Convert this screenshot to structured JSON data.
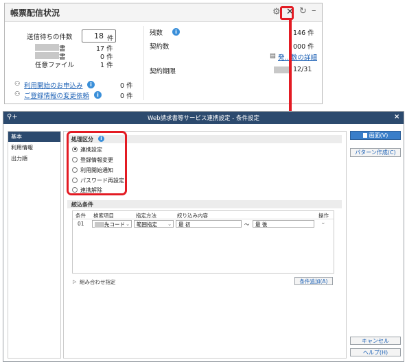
{
  "widget": {
    "title": "帳票配信状況",
    "pending_label": "送信待ちの件数",
    "pending_value": "18",
    "pending_unit": "件",
    "rows": [
      {
        "label": "書",
        "value": "17 件"
      },
      {
        "label": "書",
        "value": "0 件"
      },
      {
        "label": "任意ファイル",
        "value": "1 件"
      }
    ],
    "links": [
      {
        "label": "利用開始のお申込み",
        "value": "0 件"
      },
      {
        "label": "ご登録情報の変更依頼",
        "value": "0 件"
      }
    ],
    "right": {
      "remaining_label": "残数",
      "remaining_value": "146 件",
      "contract_label": "契約数",
      "contract_value": "000 件",
      "detail_link": "発…数の詳細",
      "period_label": "契約期限",
      "period_value": "12/31"
    }
  },
  "dialog": {
    "title": "Web請求書等サービス連携設定 - 条件設定",
    "nav": [
      "基本",
      "利用情報",
      "出力順"
    ],
    "section_process": "処理区分",
    "radios": [
      {
        "label": "連携設定",
        "selected": true
      },
      {
        "label": "登録情報変更",
        "selected": false
      },
      {
        "label": "利用開始通知",
        "selected": false
      },
      {
        "label": "パスワード再設定",
        "selected": false
      },
      {
        "label": "連携解除",
        "selected": false
      }
    ],
    "section_filter": "絞込条件",
    "table_headers": {
      "cond": "条件",
      "item": "検索項目",
      "method": "指定方法",
      "content": "絞り込み内容",
      "op": "操作"
    },
    "table_row": {
      "no": "01",
      "item": "先コード",
      "method": "範囲指定",
      "from": "最 初",
      "tilde": "～",
      "to": "最 後"
    },
    "combo_label": "組み合わせ指定",
    "add_button": "条件追加(A)",
    "buttons": {
      "screen": "画面(V)",
      "pattern": "パターン作成(C)",
      "cancel": "キャンセル",
      "help": "ヘルプ(H)"
    }
  }
}
